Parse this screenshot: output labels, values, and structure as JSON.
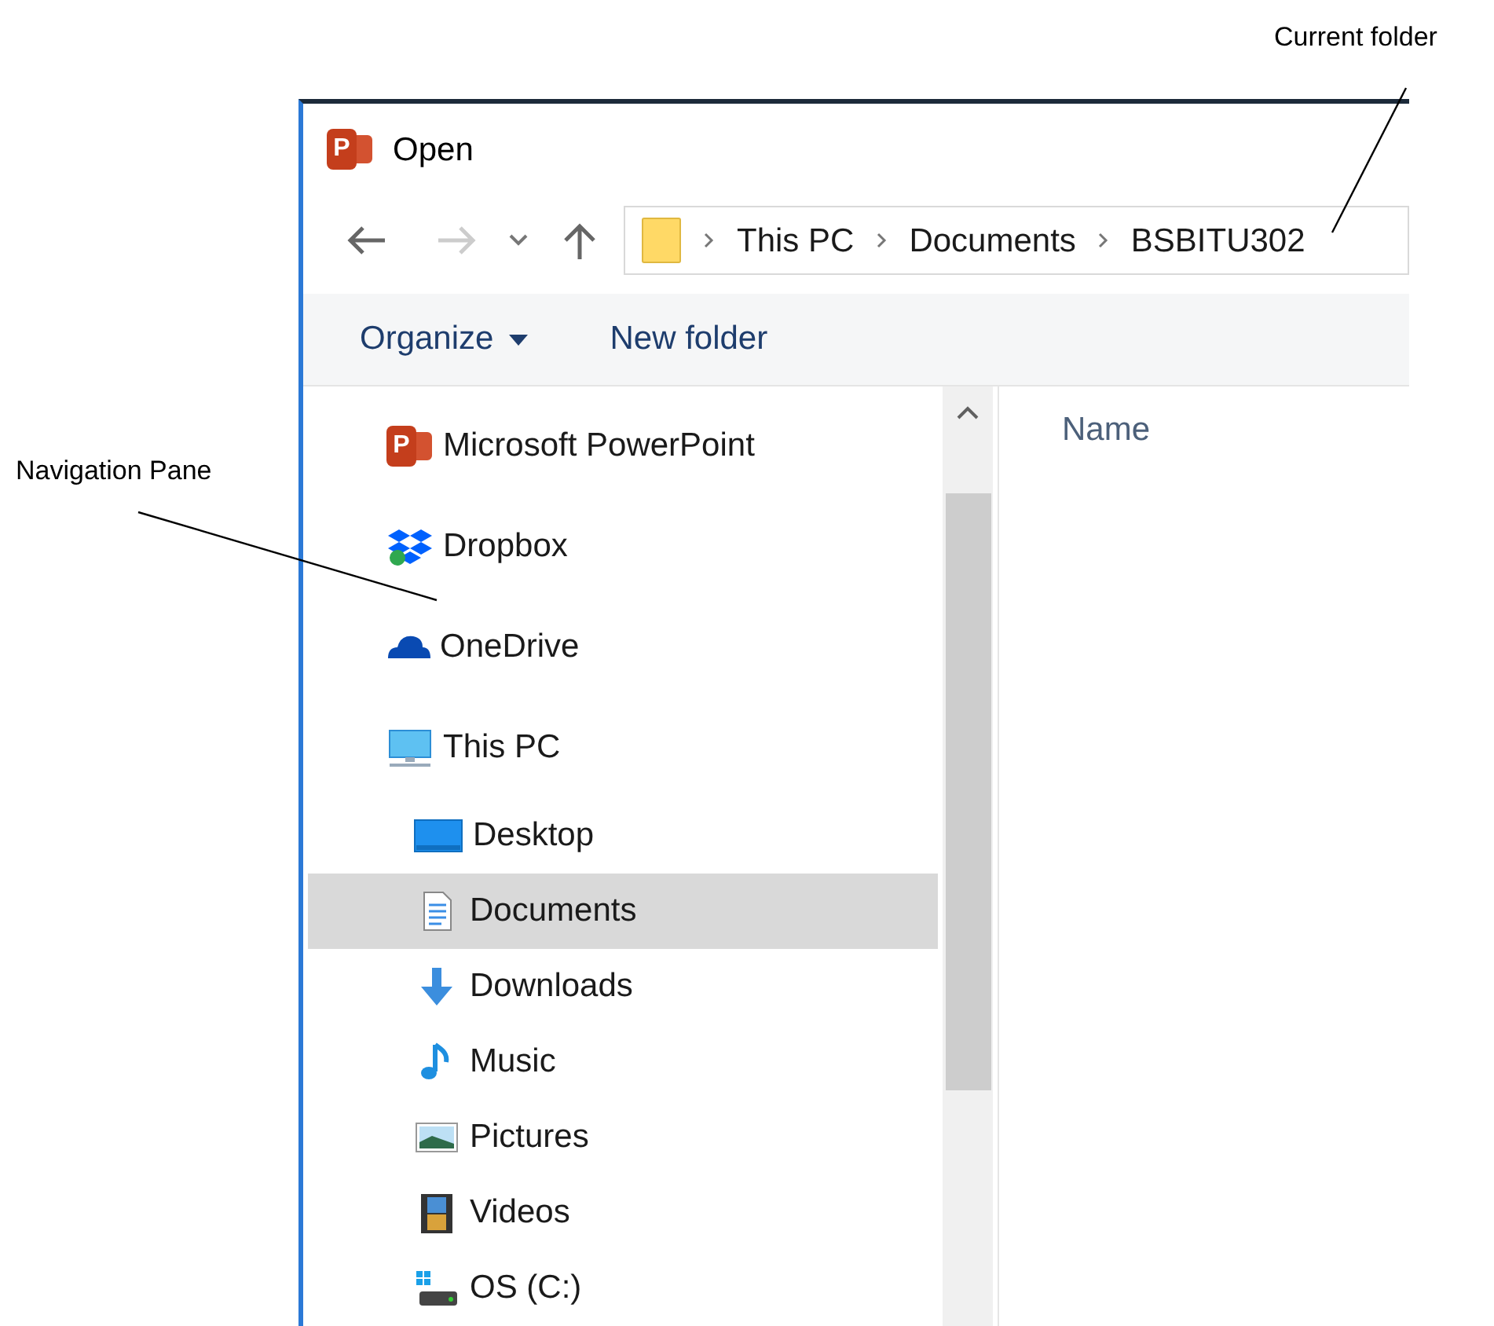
{
  "annotations": [
    {
      "text": "Current folder"
    },
    {
      "text": "Navigation Pane"
    }
  ],
  "window": {
    "app_icon_letter": "P",
    "title": "Open"
  },
  "navigation": {
    "back": {
      "disabled": false
    },
    "forward": {
      "disabled": true
    }
  },
  "breadcrumb": [
    "This PC",
    "Documents",
    "BSBITU302"
  ],
  "toolbar": {
    "organize": "Organize",
    "new_folder": "New folder"
  },
  "nav_pane": {
    "items": [
      {
        "label": "Microsoft PowerPoint",
        "selected": false,
        "icon_letter": "P"
      },
      {
        "label": "Dropbox",
        "selected": false
      },
      {
        "label": "OneDrive",
        "selected": false
      },
      {
        "label": "This PC",
        "selected": false,
        "children": [
          {
            "label": "Desktop",
            "selected": false
          },
          {
            "label": "Documents",
            "selected": true
          },
          {
            "label": "Downloads",
            "selected": false
          },
          {
            "label": "Music",
            "selected": false
          },
          {
            "label": "Pictures",
            "selected": false
          },
          {
            "label": "Videos",
            "selected": false
          },
          {
            "label": "OS (C:)",
            "selected": false
          }
        ]
      }
    ]
  },
  "file_list": {
    "columns": [
      "Name"
    ]
  }
}
